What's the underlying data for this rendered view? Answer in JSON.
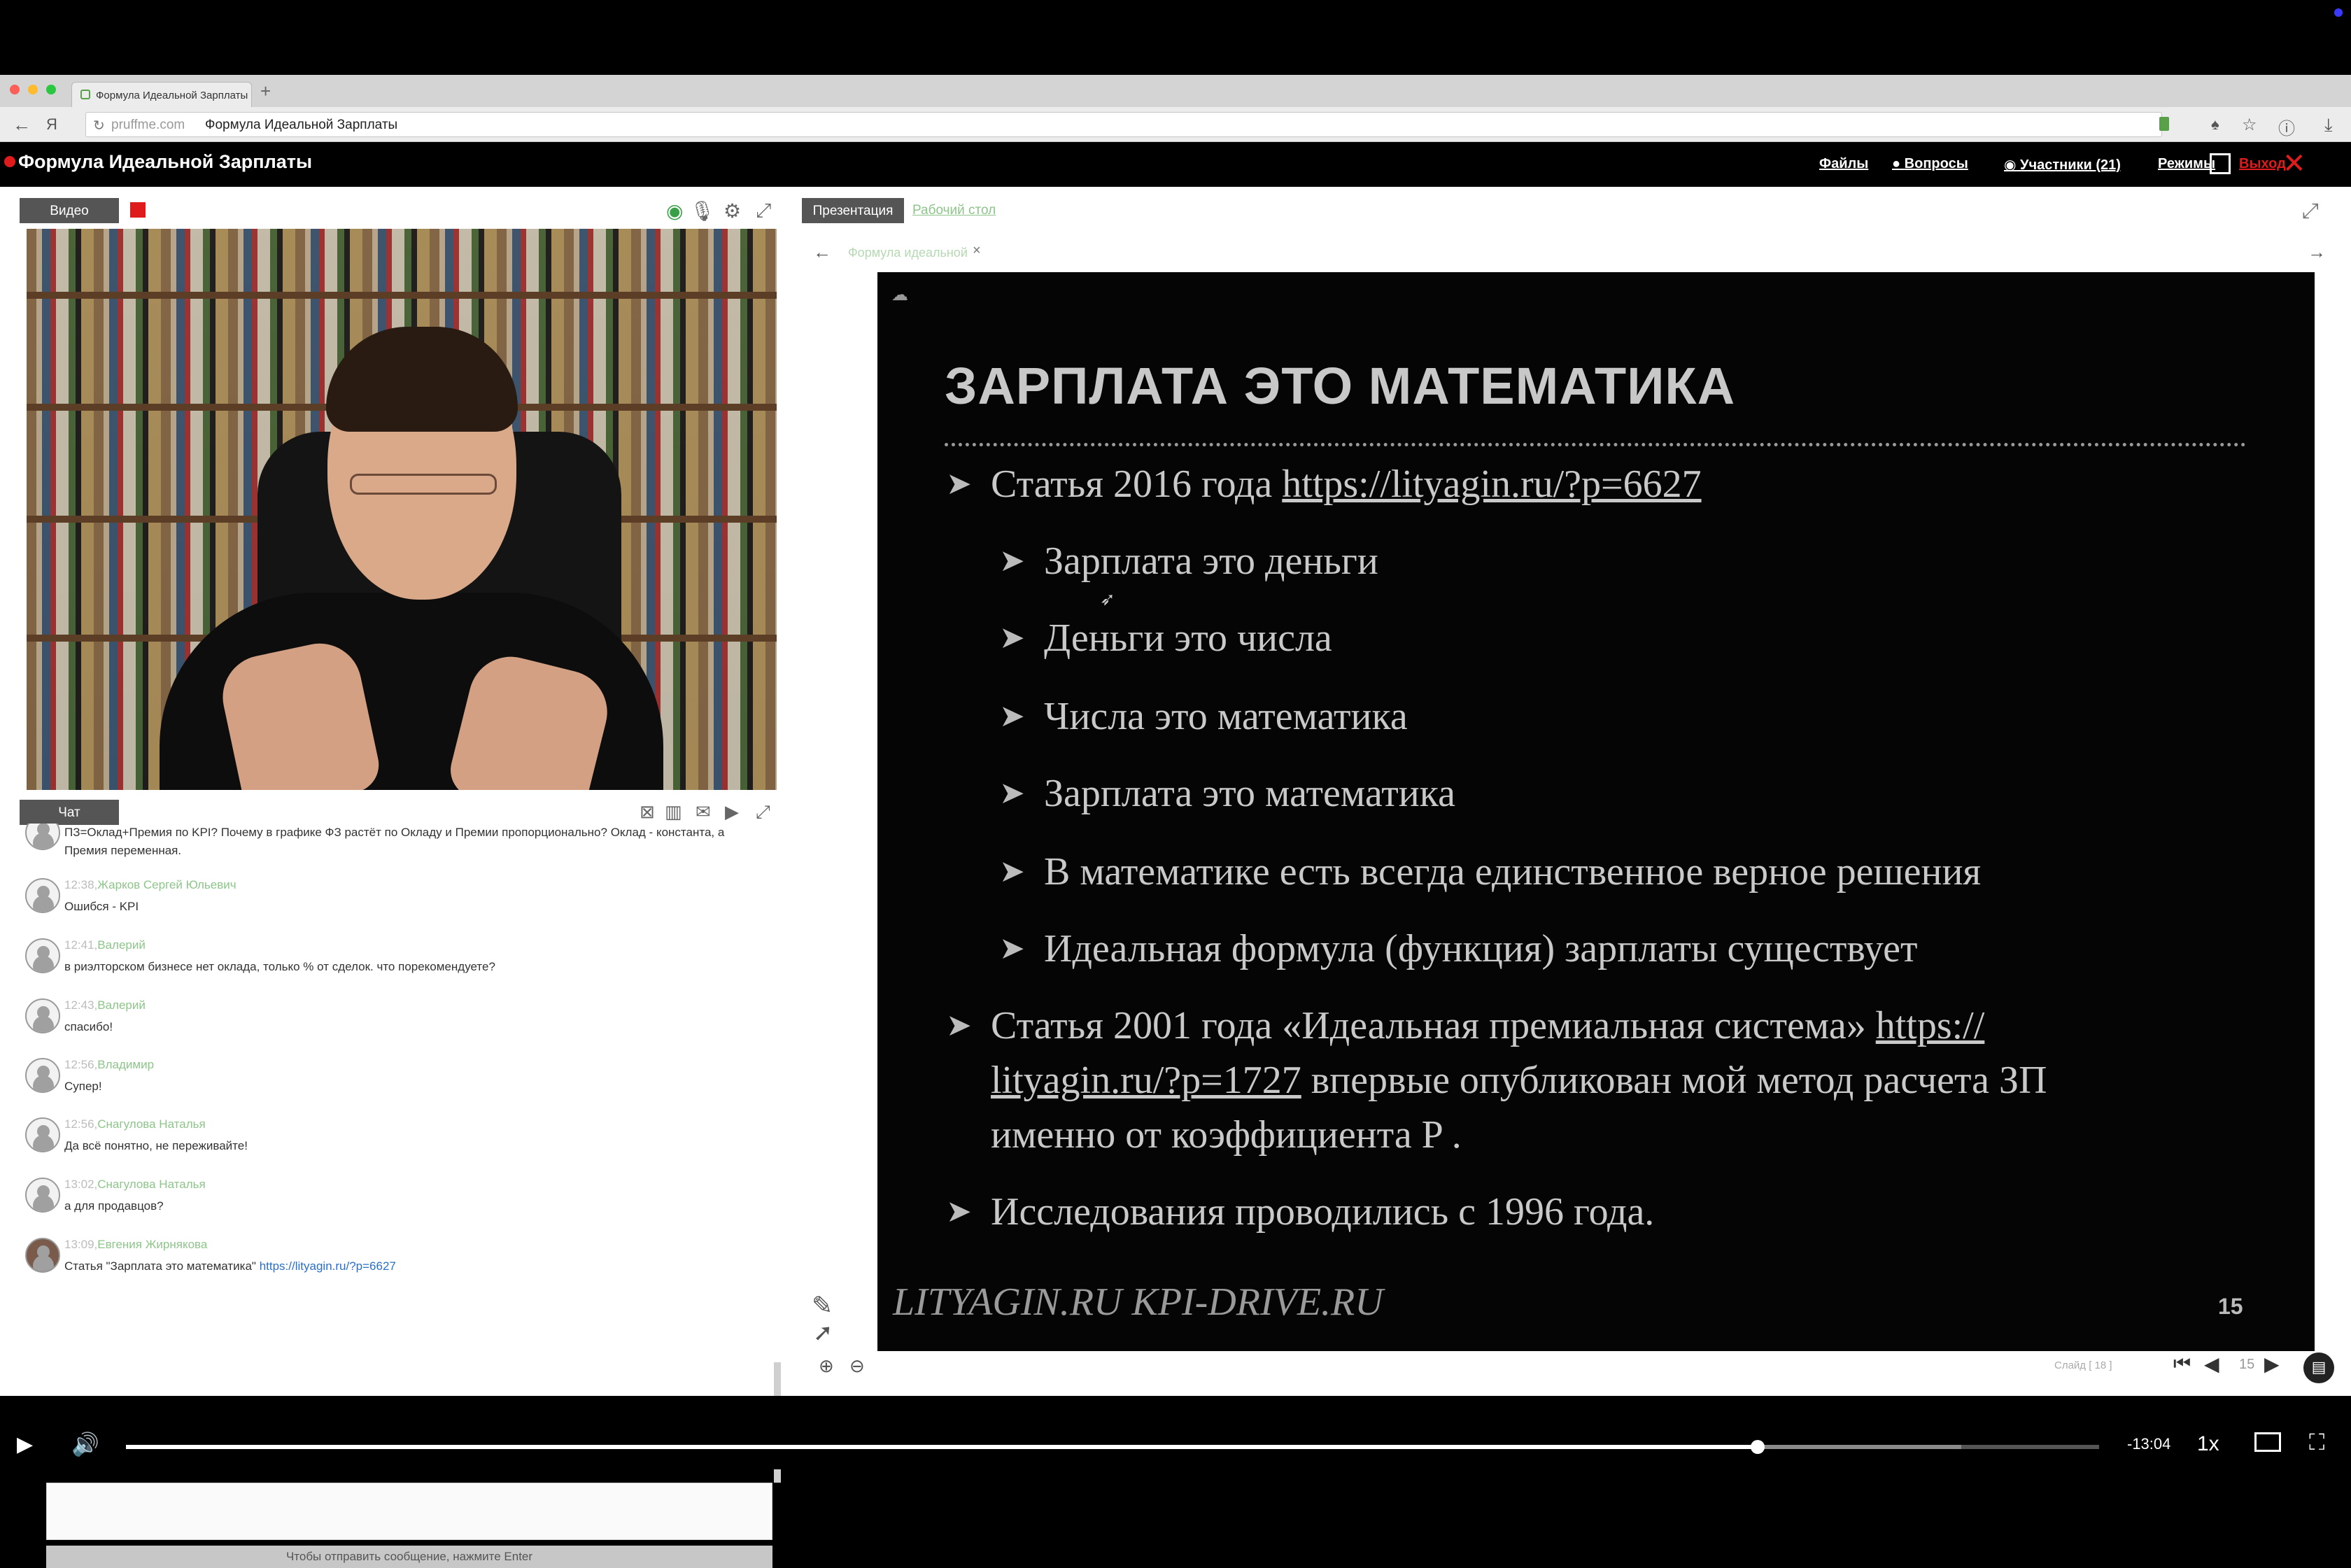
{
  "browser": {
    "tab_title": "Формула Идеальной Зарплаты",
    "url_host": "pruffme.com",
    "url_path": "Формула Идеальной Зарплаты"
  },
  "app": {
    "title": "Формула Идеальной Зарплаты",
    "nav": {
      "files": "Файлы",
      "questions": "Вопросы",
      "participants": "Участники (21)",
      "modes": "Режимы",
      "exit": "Выход"
    }
  },
  "video_panel": {
    "tab_label": "Видео"
  },
  "chat": {
    "tab_label": "Чат",
    "messages": [
      {
        "time": "",
        "author": "",
        "text": "ПЗ=Оклад+Премия по KPI? Почему в графике ФЗ растёт по Окладу и Премии пропорционально? Оклад - константа, а Премия переменная."
      },
      {
        "time": "12:38,",
        "author": "Жарков Сергей Юльевич",
        "text": "Ошибся - KPI"
      },
      {
        "time": "12:41,",
        "author": "Валерий",
        "text": "в риэлторском бизнесе нет оклада, только % от сделок. что порекомендуете?"
      },
      {
        "time": "12:43,",
        "author": "Валерий",
        "text": "спасибо!"
      },
      {
        "time": "12:56,",
        "author": "Владимир",
        "text": "Супер!"
      },
      {
        "time": "12:56,",
        "author": "Снагулова Наталья",
        "text": "Да всё понятно, не переживайте!"
      },
      {
        "time": "13:02,",
        "author": "Снагулова Наталья",
        "text": "а для продавцов?"
      },
      {
        "time": "13:09,",
        "author": "Евгения Жирнякова",
        "text": "Статья \"Зарплата это математика\"",
        "link": "https://lityagin.ru/?p=6627"
      }
    ],
    "send_hint": "Чтобы отправить сообщение, нажмите Enter"
  },
  "presentation": {
    "tab_label": "Презентация",
    "desktop_label": "Рабочий стол",
    "doc_tab": "Формула идеальной",
    "slide": {
      "title": "ЗАРПЛАТА ЭТО МАТЕМАТИКА",
      "b1_text": "Статья 2016 года ",
      "b1_link": "https://lityagin.ru/?p=6627",
      "sub": [
        "Зарплата это деньги",
        "Деньги это числа",
        "Числа это математика",
        "Зарплата это математика",
        "В математике есть всегда единственное верное решения",
        "Идеальная формула (функция) зарплаты существует"
      ],
      "b2_line1_text": "Статья 2001 года «Идеальная премиальная система» ",
      "b2_line1_link": "https://",
      "b2_line2_link": "lityagin.ru/?p=1727",
      "b2_line2_text": " впервые опубликован мой метод расчета ЗП",
      "b2_line3": "именно от коэффициента P .",
      "b3": "Исследования проводились с 1996 года.",
      "footer": "LITYAGIN.RU  KPI-DRIVE.RU",
      "page_number": "15"
    },
    "pager": {
      "label": "Слайд [ 18 ]",
      "current": "15"
    }
  },
  "player": {
    "time_remaining": "-13:04",
    "speed": "1x",
    "progress": 0.827,
    "buffered": 0.93
  },
  "icons": {
    "mic": "microphone-icon",
    "settings": "gear-icon",
    "expand": "expand-icon",
    "pen": "pen-icon",
    "pointer": "pointer-icon"
  }
}
